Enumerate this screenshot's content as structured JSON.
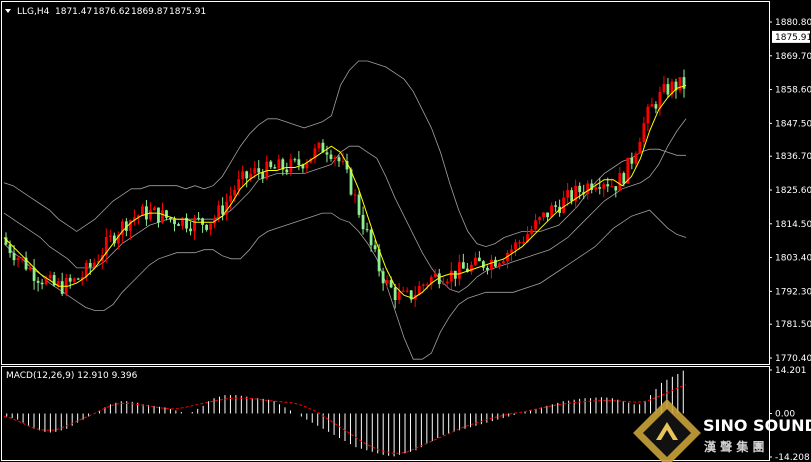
{
  "main_panel": {
    "symbol": "LLG,H4",
    "ohlc": [
      "1871.47",
      "1876.62",
      "1869.87",
      "1875.91"
    ],
    "menu_arrow_icon": "triangle-down-icon"
  },
  "price_axis": {
    "ticks": [
      "1880.80",
      "1869.70",
      "1858.60",
      "1847.50",
      "1836.70",
      "1825.60",
      "1814.50",
      "1803.40",
      "1792.30",
      "1781.50",
      "1770.40"
    ],
    "current_label": "1875.91"
  },
  "macd_panel": {
    "label": "MACD(12,26,9) 12.910 9.396",
    "ticks": [
      "14.201",
      "0.00",
      "-14.208"
    ]
  },
  "watermark": {
    "brand": "SINO SOUND",
    "chinese": "漢 聲 集 團"
  },
  "colors": {
    "background": "#000000",
    "bull_candle": "#ff0000",
    "bear_candle": "#90ee90",
    "bollinger": "#a0a0a0",
    "moving_average": "#ffff00",
    "macd_histogram": "#ffffff",
    "macd_signal": "#ff0000",
    "axis": "#ffffff"
  },
  "chart_data": [
    {
      "type": "candlestick",
      "title": "LLG,H4",
      "ylim": [
        1770.4,
        1880.8
      ],
      "grid": false,
      "bollinger_upper": [
        1828,
        1827,
        1825,
        1823,
        1821,
        1819,
        1816,
        1814,
        1812,
        1814,
        1816,
        1819,
        1822,
        1824,
        1826,
        1826,
        1827,
        1827,
        1827,
        1827,
        1826,
        1827,
        1826,
        1827,
        1830,
        1835,
        1840,
        1844,
        1847,
        1849,
        1849,
        1848,
        1847,
        1846,
        1847,
        1848,
        1850,
        1860,
        1865,
        1868,
        1868,
        1867,
        1866,
        1864,
        1862,
        1858,
        1852,
        1846,
        1838,
        1828,
        1819,
        1812,
        1808,
        1807,
        1808,
        1810,
        1811,
        1812,
        1812,
        1812,
        1813,
        1814,
        1817,
        1820,
        1824,
        1828,
        1831,
        1833,
        1835,
        1836,
        1838,
        1839,
        1839,
        1838,
        1837,
        1837
      ],
      "bollinger_middle": [
        1818,
        1816,
        1814,
        1812,
        1810,
        1807,
        1805,
        1803,
        1800,
        1800,
        1800,
        1802,
        1805,
        1808,
        1810,
        1812,
        1814,
        1815,
        1816,
        1816,
        1816,
        1816,
        1816,
        1816,
        1817,
        1819,
        1822,
        1825,
        1829,
        1830,
        1831,
        1831,
        1831,
        1831,
        1832,
        1833,
        1834,
        1838,
        1840,
        1840,
        1838,
        1836,
        1830,
        1823,
        1817,
        1811,
        1805,
        1800,
        1796,
        1793,
        1792,
        1794,
        1797,
        1799,
        1800,
        1801,
        1802,
        1803,
        1804,
        1805,
        1806,
        1808,
        1810,
        1813,
        1816,
        1819,
        1822,
        1824,
        1826,
        1827,
        1828,
        1830,
        1834,
        1840,
        1845,
        1849
      ],
      "bollinger_lower": [
        1808,
        1805,
        1803,
        1800,
        1798,
        1795,
        1793,
        1791,
        1789,
        1787,
        1786,
        1786,
        1788,
        1792,
        1795,
        1798,
        1801,
        1803,
        1804,
        1805,
        1805,
        1805,
        1806,
        1806,
        1804,
        1803,
        1803,
        1806,
        1810,
        1812,
        1813,
        1814,
        1815,
        1816,
        1817,
        1818,
        1818,
        1816,
        1815,
        1812,
        1808,
        1803,
        1795,
        1786,
        1777,
        1770,
        1770,
        1772,
        1779,
        1784,
        1788,
        1790,
        1791,
        1792,
        1792,
        1792,
        1792,
        1793,
        1794,
        1795,
        1797,
        1799,
        1801,
        1803,
        1805,
        1807,
        1810,
        1813,
        1815,
        1817,
        1818,
        1819,
        1816,
        1813,
        1811,
        1810
      ],
      "moving_average": [
        1810,
        1807,
        1804,
        1801,
        1798,
        1796,
        1794,
        1794,
        1795,
        1797,
        1800,
        1804,
        1808,
        1812,
        1815,
        1817,
        1818,
        1818,
        1817,
        1816,
        1816,
        1815,
        1815,
        1815,
        1817,
        1821,
        1826,
        1829,
        1831,
        1832,
        1832,
        1833,
        1833,
        1834,
        1836,
        1838,
        1840,
        1838,
        1833,
        1826,
        1817,
        1808,
        1800,
        1794,
        1791,
        1790,
        1792,
        1795,
        1797,
        1798,
        1798,
        1799,
        1800,
        1801,
        1802,
        1803,
        1805,
        1807,
        1810,
        1813,
        1816,
        1819,
        1821,
        1823,
        1825,
        1827,
        1829,
        1829,
        1827,
        1830,
        1836,
        1845,
        1852,
        1856,
        1859,
        1860
      ]
    },
    {
      "type": "bar",
      "title": "MACD(12,26,9) 12.910 9.396",
      "ylim": [
        -14.208,
        14.201
      ],
      "histogram": [
        -1,
        -1.5,
        -2,
        -3,
        -4,
        -5,
        -5.5,
        -6,
        -6.2,
        -6,
        -5.5,
        -5,
        -4,
        -3,
        -2,
        -1,
        0,
        1,
        2,
        3,
        3.5,
        4,
        4,
        3.8,
        3.5,
        3,
        2.8,
        2.5,
        2.2,
        2,
        1.5,
        1,
        0.5,
        0,
        0.5,
        1.5,
        2.5,
        4,
        5,
        5.5,
        6,
        6,
        6,
        5.8,
        5.5,
        5,
        5,
        4.8,
        4.5,
        4,
        3,
        2,
        1,
        0,
        -1,
        -2,
        -3,
        -4,
        -5,
        -6,
        -7,
        -8,
        -9,
        -10,
        -11,
        -11.5,
        -12,
        -12.5,
        -13,
        -13.5,
        -13.8,
        -14,
        -13.5,
        -13,
        -12.5,
        -12,
        -11,
        -10,
        -9,
        -8,
        -7,
        -6.5,
        -6,
        -5.5,
        -5,
        -4.5,
        -4,
        -3.5,
        -3,
        -2.5,
        -2,
        -1.5,
        -1,
        -0.5,
        0,
        0.5,
        1,
        1.5,
        2,
        2.5,
        3,
        3.5,
        4,
        4.2,
        4.5,
        4.8,
        5,
        5,
        5.2,
        5.3,
        5.2,
        5,
        4.5,
        4,
        3.5,
        3,
        3,
        4,
        6,
        8,
        10,
        11,
        12,
        12.9,
        14
      ],
      "signal": [
        -1,
        -1.5,
        -2.5,
        -3.5,
        -4.5,
        -5.2,
        -5.5,
        -5.5,
        -5,
        -4,
        -3,
        -2,
        -1,
        0,
        1.2,
        2.2,
        3,
        3.3,
        3.3,
        3,
        2.7,
        2.4,
        2,
        1.7,
        1.5,
        1.6,
        2,
        2.5,
        3,
        3.5,
        4,
        4.4,
        4.8,
        5,
        5,
        5,
        4.8,
        4.5,
        4.2,
        4,
        3.8,
        3.6,
        3.2,
        2.5,
        1.5,
        0.5,
        -1,
        -2.5,
        -4,
        -5.5,
        -7,
        -8.5,
        -10,
        -11,
        -12,
        -12.5,
        -13,
        -13,
        -12.5,
        -11.5,
        -10.5,
        -9.5,
        -8.5,
        -7.5,
        -6.5,
        -5.5,
        -4.5,
        -3.7,
        -3,
        -2.3,
        -1.6,
        -1,
        -0.5,
        0,
        0.3,
        0.7,
        1.2,
        1.7,
        2.2,
        2.6,
        3,
        3.3,
        3.6,
        3.8,
        4,
        4.1,
        4.2,
        4.2,
        4.1,
        4,
        3.8,
        3.7,
        3.9,
        4.5,
        5.5,
        6.5,
        7.5,
        8.5,
        9.396
      ]
    }
  ]
}
